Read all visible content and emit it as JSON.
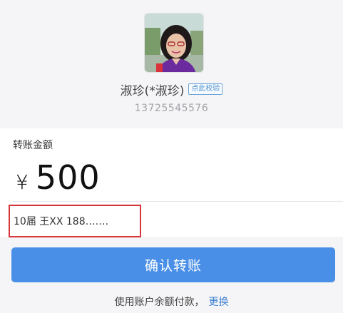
{
  "recipient": {
    "name": "淑珍(*淑珍)",
    "verify_label": "点此校验",
    "phone": "13725545576"
  },
  "transfer": {
    "amount_label": "转账金额",
    "currency_symbol": "¥",
    "amount": "500",
    "note": "10届 王XX  188……."
  },
  "actions": {
    "confirm_label": "确认转账",
    "payment_method_text": "使用账户余额付款，",
    "change_label": "更换"
  },
  "colors": {
    "primary_button": "#4a8fe7",
    "link": "#3b7fd1",
    "highlight_border": "#d4363a"
  }
}
